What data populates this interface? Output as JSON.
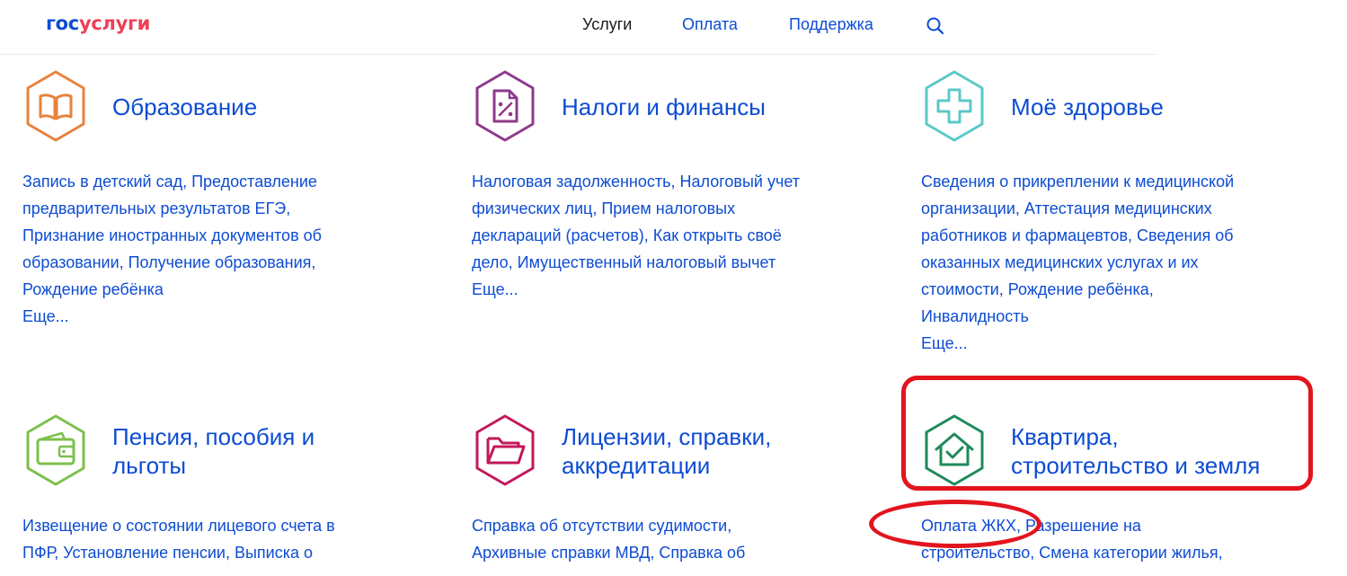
{
  "header": {
    "logo_part1": "гос",
    "logo_part2": "услуги",
    "nav": [
      "Услуги",
      "Оплата",
      "Поддержка"
    ],
    "search_icon": "search-icon"
  },
  "colors": {
    "brand_blue": "#0d4cd3",
    "brand_red": "#ee3f58",
    "annotation_red": "#e2141e"
  },
  "cards": [
    {
      "title": [
        "Образование"
      ],
      "icon": "book-icon",
      "icon_color": "#e8823c",
      "links": [
        "Запись в детский сад, Предоставление",
        "предварительных результатов ЕГЭ,",
        "Признание иностранных документов об",
        "образовании, Получение образования,",
        "Рождение ребёнка",
        "Еще..."
      ]
    },
    {
      "title": [
        "Налоги и финансы"
      ],
      "icon": "tax-document-icon",
      "icon_color": "#8e3a8c",
      "links": [
        "Налоговая задолженность, Налоговый учет",
        "физических лиц, Прием налоговых",
        "деклараций (расчетов), Как открыть своё",
        "дело, Имущественный налоговый вычет",
        "Еще..."
      ]
    },
    {
      "title": [
        "Моё здоровье"
      ],
      "icon": "medical-cross-icon",
      "icon_color": "#5cc8c8",
      "links": [
        "Сведения о прикреплении к медицинской",
        "организации, Аттестация медицинских",
        "работников и фармацевтов, Сведения об",
        "оказанных медицинских услугах и их",
        "стоимости, Рождение ребёнка,",
        "Инвалидность",
        "Еще..."
      ]
    },
    {
      "title": [
        "Пенсия, пособия и",
        "льготы"
      ],
      "icon": "wallet-icon",
      "icon_color": "#7cc04b",
      "links": [
        "Извещение о состоянии лицевого счета в",
        "ПФР, Установление пенсии, Выписка о"
      ]
    },
    {
      "title": [
        "Лицензии, справки,",
        "аккредитации"
      ],
      "icon": "folder-icon",
      "icon_color": "#c2185b",
      "links": [
        "Справка об отсутствии судимости,",
        "Архивные справки МВД, Справка об"
      ]
    },
    {
      "title": [
        "Квартира,",
        "строительство и земля"
      ],
      "icon": "house-check-icon",
      "icon_color": "#1e8a5a",
      "links": [
        "Оплата ЖКХ, Разрешение на",
        "строительство, Смена категории жилья,"
      ]
    }
  ]
}
